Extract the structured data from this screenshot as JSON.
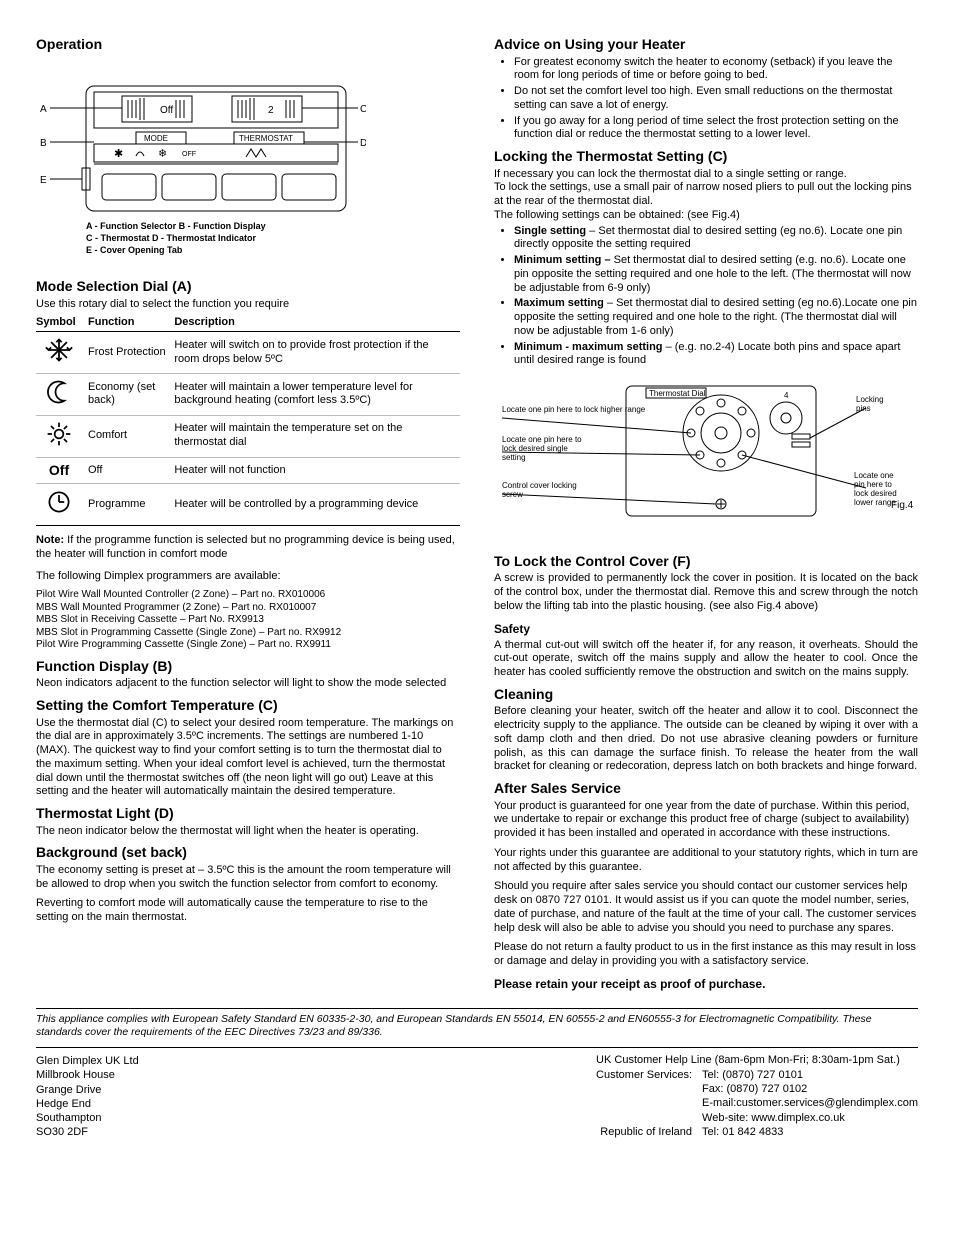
{
  "left": {
    "operation_h": "Operation",
    "fig1_labels": {
      "A": "A",
      "B": "B",
      "C": "C",
      "D": "D",
      "E": "E",
      "mode": "MODE",
      "thermostat": "THERMOSTAT",
      "off": "Off",
      "two": "2",
      "legend1": "A - Function Selector   B - Function Display",
      "legend2": "C - Thermostat   D - Thermostat Indicator",
      "legend3": "E - Cover Opening Tab"
    },
    "mode_h": "Mode Selection Dial (A)",
    "mode_intro": "Use this rotary dial to select the function you require",
    "mode_cols": [
      "Symbol",
      "Function",
      "Description"
    ],
    "mode_rows": [
      {
        "sym": "frost",
        "fn": "Frost Protection",
        "desc": "Heater will switch on to provide frost protection if the room drops below 5ºC"
      },
      {
        "sym": "moon",
        "fn": "Economy (set back)",
        "desc": "Heater will maintain a lower temperature level for background heating (comfort less 3.5ºC)"
      },
      {
        "sym": "sun",
        "fn": "Comfort",
        "desc": "Heater will maintain the temperature set on the thermostat dial"
      },
      {
        "sym": "off",
        "fn": "Off",
        "desc": "Heater will not function"
      },
      {
        "sym": "clock",
        "fn": "Programme",
        "desc": "Heater will be controlled by a programming device"
      }
    ],
    "note_label": "Note:",
    "note_text": " If the programme function is selected but no programming device is being used, the heater will function in comfort mode",
    "prog_intro": "The following Dimplex programmers are available:",
    "prog_list": [
      "Pilot Wire Wall Mounted Controller (2 Zone) – Part no. RX010006",
      "MBS Wall Mounted Programmer (2 Zone) – Part no. RX010007",
      "MBS Slot in Receiving Cassette – Part No. RX9913",
      "MBS Slot in Programming Cassette (Single Zone) – Part no. RX9912",
      "Pilot Wire Programming Cassette (Single Zone) – Part no. RX9911"
    ],
    "fd_h": "Function Display (B)",
    "fd_p": "Neon indicators adjacent to the function selector will light to show the mode selected",
    "sct_h": "Setting the Comfort Temperature (C)",
    "sct_p": "Use the thermostat dial (C) to select your desired room temperature. The markings on the dial are in approximately 3.5ºC increments. The settings are numbered 1-10 (MAX). The quickest way to find your comfort setting is to turn the thermostat dial to the maximum setting. When your ideal comfort level is achieved, turn the thermostat dial down until the thermostat switches off (the neon light will go out) Leave at this setting and the heater will automatically maintain the desired temperature.",
    "tl_h": "Thermostat Light (D)",
    "tl_p": "The neon indicator below the thermostat will light when the heater is operating.",
    "bg_h": "Background (set back)",
    "bg_p1": "The economy setting is preset at – 3.5ºC this is the amount the room temperature will be allowed to drop when you switch the function selector from comfort to economy.",
    "bg_p2": "Reverting to comfort mode will automatically cause the temperature to rise to the setting on the main thermostat."
  },
  "right": {
    "advice_h": "Advice on Using your Heater",
    "advice_list": [
      "For greatest economy switch the heater to economy (setback) if you leave the room for long periods of time or before going to bed.",
      "Do not set the comfort level too high. Even small reductions on the thermostat setting can save a lot of energy.",
      "If you go away for a long period of time select the frost protection setting on the function dial or reduce the thermostat setting to a lower level."
    ],
    "lock_h": "Locking the Thermostat Setting (C)",
    "lock_p1": "If necessary you can lock the thermostat dial to a single setting or range.",
    "lock_p2": "To lock the settings, use a small pair of narrow nosed pliers to pull out the locking pins at the rear of the thermostat dial.",
    "lock_p3": "The following settings can be obtained: (see Fig.4)",
    "lock_items": [
      {
        "b": "Single setting",
        "t": " – Set thermostat dial to desired setting (eg no.6). Locate one pin directly opposite the setting required"
      },
      {
        "b": "Minimum setting –",
        "t": " Set thermostat dial to desired setting (e.g. no.6). Locate one pin opposite the setting required and one hole to the left. (The thermostat will now be adjustable from 6-9 only)"
      },
      {
        "b": "Maximum setting",
        "t": " – Set thermostat dial to desired setting (eg no.6).Locate one pin opposite the setting required and one hole to the right. (The thermostat dial will now be adjustable from 1-6 only)"
      },
      {
        "b": "Minimum - maximum setting",
        "t": " – (e.g. no.2-4) Locate both pins and space apart until desired range is found"
      }
    ],
    "fig4_labels": {
      "dial": "Thermostat Dial",
      "pins": "Locking pins",
      "higher": "Locate one pin here to lock higher range",
      "single": "Locate one pin here to lock desired single setting",
      "screw": "Control cover locking screw",
      "lower": "Locate one pin here to lock desired lower range",
      "four": "4",
      "cap": "Fig.4"
    },
    "lcc_h": "To Lock the Control Cover (F)",
    "lcc_p": "A screw is provided to permanently lock the cover in position. It is located on the back of the control box, under the thermostat dial. Remove this and screw through the notch below the lifting tab into the plastic housing. (see also Fig.4 above)",
    "safety_h": "Safety",
    "safety_p": "A thermal cut-out will switch off the heater if, for any reason, it overheats. Should the cut-out operate, switch off the mains supply and allow the heater to cool. Once the heater has cooled sufficiently remove the obstruction and switch on the mains supply.",
    "clean_h": "Cleaning",
    "clean_p": "Before cleaning your heater, switch off the heater and allow it to cool. Disconnect the electricity supply to the appliance. The outside can be cleaned by wiping it over with a soft damp cloth and then dried. Do not use abrasive cleaning powders or furniture polish, as this can damage the surface finish. To release the heater from the wall bracket for cleaning or redecoration, depress latch on both brackets and hinge forward.",
    "ass_h": "After Sales Service",
    "ass_p1": "Your product is guaranteed for one year from the date of purchase. Within this period, we undertake to repair or exchange this product free of charge (subject to availability) provided it has been installed and operated in accordance with these instructions.",
    "ass_p2": "Your rights under this guarantee are additional to your statutory rights, which in turn are not affected by this guarantee.",
    "ass_p3": "Should you require after sales service you should contact our customer services help desk on 0870 727 0101.  It would assist us if you can quote the model number, series, date of purchase, and nature of the fault at the time of your call.  The customer services help desk will also be able to advise you should you need to purchase any spares.",
    "ass_p4": "Please do not return a faulty product to us in the first instance as this may result in loss or damage and delay in providing you with a satisfactory service.",
    "retain": "Please retain your receipt as proof of purchase."
  },
  "compliance": "This appliance complies with European Safety Standard EN 60335-2-30, and European Standards EN 55014, EN 60555-2 and EN60555-3 for Electromagnetic Compatibility. These standards cover the requirements of the EEC Directives 73/23 and 89/336.",
  "footer": {
    "addr": [
      "Glen Dimplex UK Ltd",
      "Millbrook House",
      "Grange Drive",
      "Hedge End",
      "Southampton",
      "SO30 2DF"
    ],
    "right_header": "UK Customer Help Line (8am-6pm Mon-Fri; 8:30am-1pm Sat.)",
    "labels": [
      "Customer Services:",
      "",
      "",
      "",
      "Republic of Ireland"
    ],
    "values": [
      "Tel: (0870) 727 0101",
      "Fax: (0870) 727 0102",
      "E-mail:customer.services@glendimplex.com",
      "Web-site: www.dimplex.co.uk",
      "Tel: 01 842 4833"
    ]
  }
}
